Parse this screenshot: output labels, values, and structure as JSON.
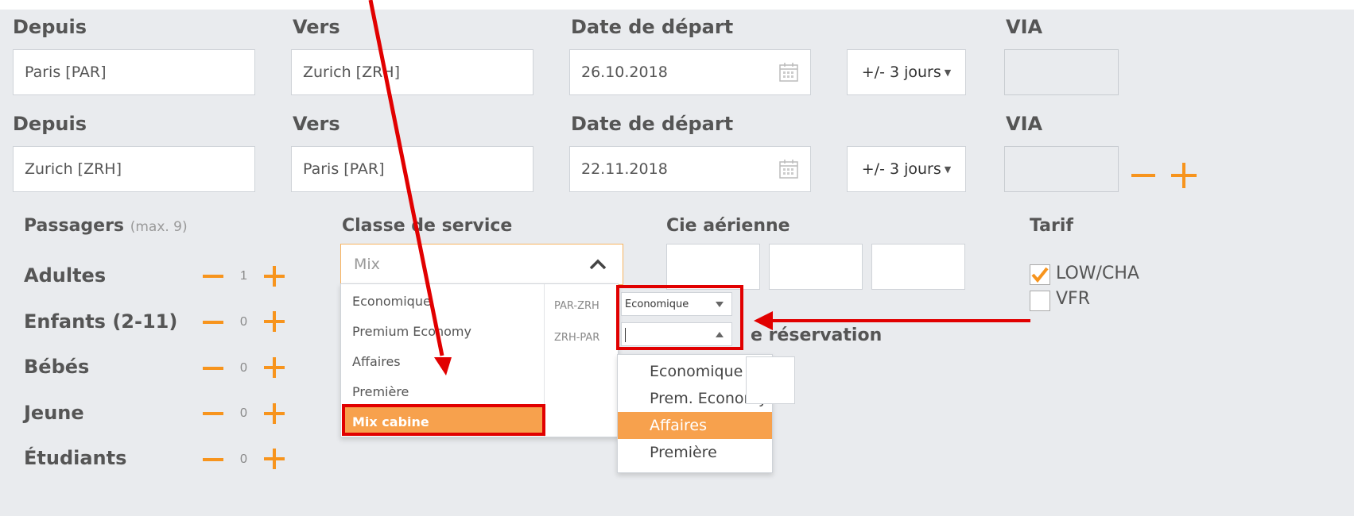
{
  "row1": {
    "from_label": "Depuis",
    "to_label": "Vers",
    "date_label": "Date de départ",
    "via_label": "VIA",
    "from_value": "Paris [PAR]",
    "to_value": "Zurich [ZRH]",
    "date_value": "26.10.2018",
    "flex_label": "+/- 3 jours"
  },
  "row2": {
    "from_label": "Depuis",
    "to_label": "Vers",
    "date_label": "Date de départ",
    "via_label": "VIA",
    "from_value": "Zurich [ZRH]",
    "to_value": "Paris [PAR]",
    "date_value": "22.11.2018",
    "flex_label": "+/- 3 jours"
  },
  "passengers": {
    "title": "Passagers",
    "max_note": "(max. 9)",
    "rows": [
      {
        "label": "Adultes",
        "count": "1"
      },
      {
        "label": "Enfants (2-11)",
        "count": "0"
      },
      {
        "label": "Bébés",
        "count": "0"
      },
      {
        "label": "Jeune",
        "count": "0"
      },
      {
        "label": "Étudiants",
        "count": "0"
      }
    ]
  },
  "service_class": {
    "label": "Classe de service",
    "selected": "Mix",
    "options": [
      "Economique",
      "Premium Economy",
      "Affaires",
      "Première",
      "Mix cabine"
    ],
    "segments": [
      {
        "route": "PAR-ZRH",
        "value": "Economique"
      },
      {
        "route": "ZRH-PAR",
        "value": ""
      }
    ],
    "segment_options": [
      "Economique",
      "Prem. Economy",
      "Affaires",
      "Première"
    ]
  },
  "airline": {
    "label": "Cie aérienne"
  },
  "booking": {
    "label_fragment": "e réservation"
  },
  "tariff": {
    "label": "Tarif",
    "options": [
      {
        "label": "LOW/CHA",
        "checked": true
      },
      {
        "label": "VFR",
        "checked": false
      }
    ]
  },
  "colors": {
    "accent": "#f7941d",
    "highlight": "#f7a14d",
    "annotation": "#e10000"
  }
}
